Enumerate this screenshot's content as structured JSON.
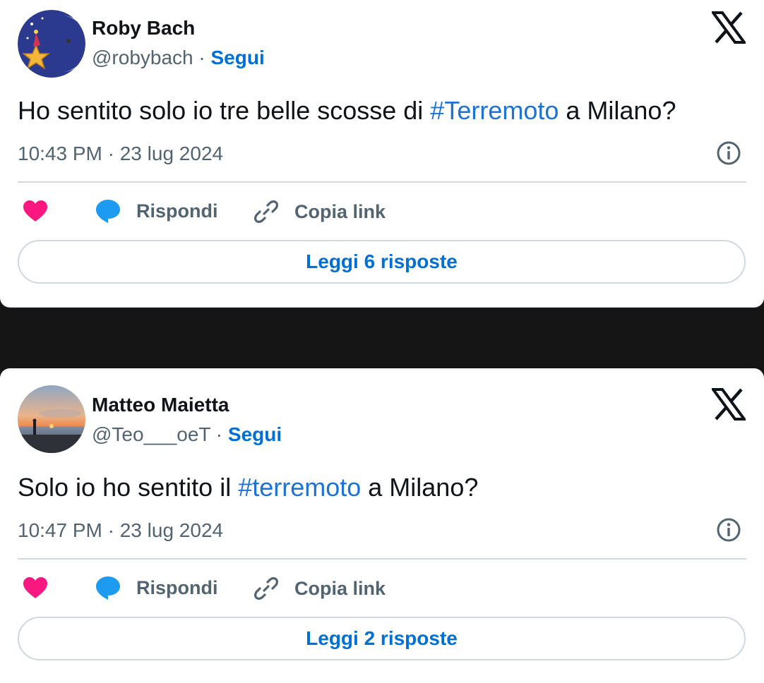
{
  "tweets": [
    {
      "author_name": "Roby Bach",
      "handle": "@robybach",
      "separator": " · ",
      "follow_label": "Segui",
      "text_before": "Ho sentito solo io tre belle scosse di ",
      "hashtag": "#Terremoto",
      "text_after": " a Milano?",
      "timestamp": "10:43 PM · 23 lug 2024",
      "reply_label": "Rispondi",
      "copy_link_label": "Copia link",
      "read_replies_label": "Leggi 6 risposte",
      "avatar": "moon-star-cartoon"
    },
    {
      "author_name": "Matteo Maietta",
      "handle": "@Teo___oeT",
      "separator": " · ",
      "follow_label": "Segui",
      "text_before": "Solo io ho sentito il ",
      "hashtag": "#terremoto",
      "text_after": " a Milano?",
      "timestamp": "10:47 PM · 23 lug 2024",
      "reply_label": "Rispondi",
      "copy_link_label": "Copia link",
      "read_replies_label": "Leggi 2 risposte",
      "avatar": "sunset-beach-photo"
    }
  ],
  "icons": {
    "like": "heart-icon",
    "reply": "speech-bubble-icon",
    "copy_link": "chain-link-icon",
    "info": "info-icon",
    "brand": "x-logo-icon"
  },
  "colors": {
    "link_blue": "#006fd6",
    "hashtag_blue": "#1d72d6",
    "heart_pink": "#f91880",
    "reply_blue": "#1d9bf0",
    "secondary_text": "#536471",
    "divider": "#cfd9de",
    "background_dark": "#151515"
  }
}
